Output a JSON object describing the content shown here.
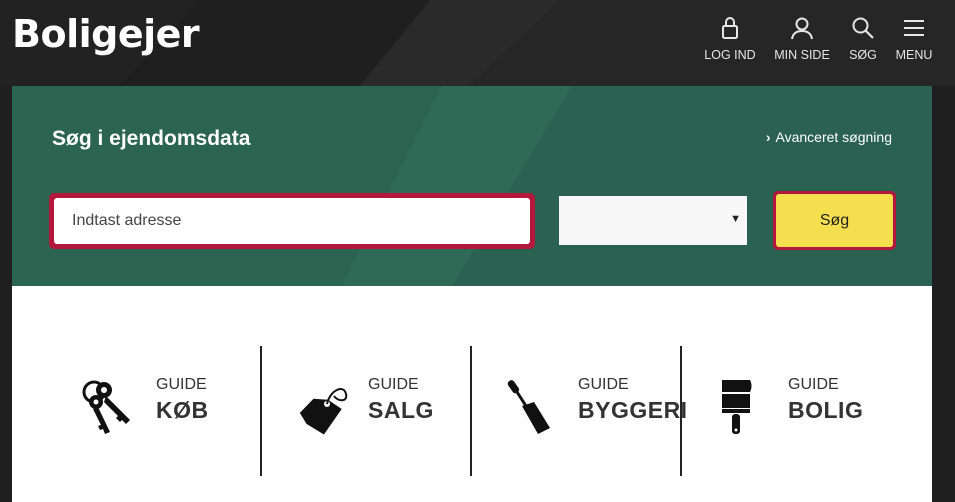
{
  "header": {
    "logo": "Boligejer",
    "nav": [
      {
        "label": "LOG IND",
        "icon": "lock-icon"
      },
      {
        "label": "MIN SIDE",
        "icon": "user-icon"
      },
      {
        "label": "SØG",
        "icon": "search-icon"
      },
      {
        "label": "MENU",
        "icon": "hamburger-menu-icon"
      }
    ]
  },
  "search": {
    "title": "Søg i ejendomsdata",
    "advanced_link": "Avanceret søgning",
    "address_placeholder": "Indtast adresse",
    "address_value": "",
    "select_value": "",
    "button_label": "Søg"
  },
  "guides": [
    {
      "small": "GUIDE",
      "big": "KØB",
      "icon": "keys-icon"
    },
    {
      "small": "GUIDE",
      "big": "SALG",
      "icon": "price-tag-icon"
    },
    {
      "small": "GUIDE",
      "big": "BYGGERI",
      "icon": "trowel-icon"
    },
    {
      "small": "GUIDE",
      "big": "BOLIG",
      "icon": "paintbrush-icon"
    }
  ],
  "colors": {
    "header_bg": "#1f1f1f",
    "panel_green": "#2c6452",
    "accent_red": "#b3183c",
    "button_yellow": "#f6df4e"
  }
}
